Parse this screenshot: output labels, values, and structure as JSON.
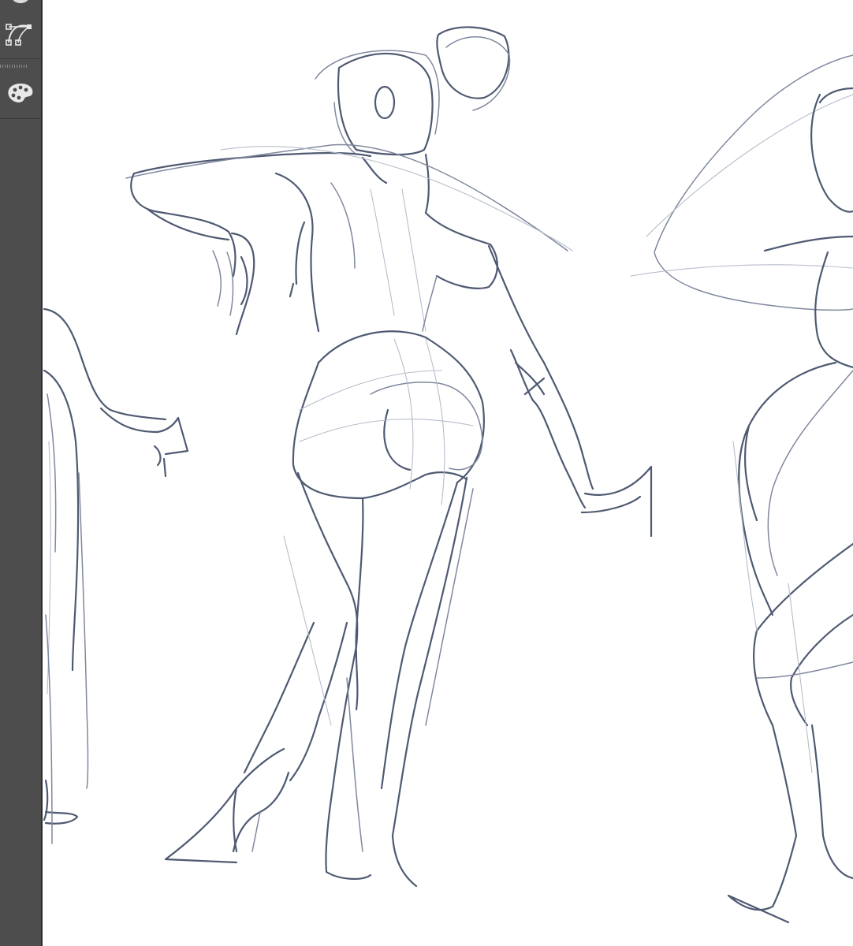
{
  "app": {
    "toolbar": {
      "tools": [
        {
          "id": "partial-tool",
          "icon": "pen-tool-partial-icon"
        },
        {
          "id": "vector-path-tool",
          "icon": "bezier-path-icon"
        },
        {
          "id": "color-palette-tool",
          "icon": "palette-icon"
        }
      ]
    },
    "canvas": {
      "background": "#ffffff",
      "stroke_colors": {
        "dark": "#4f5a72",
        "mid": "#7f889d",
        "light": "#b7bdca"
      }
    }
  }
}
